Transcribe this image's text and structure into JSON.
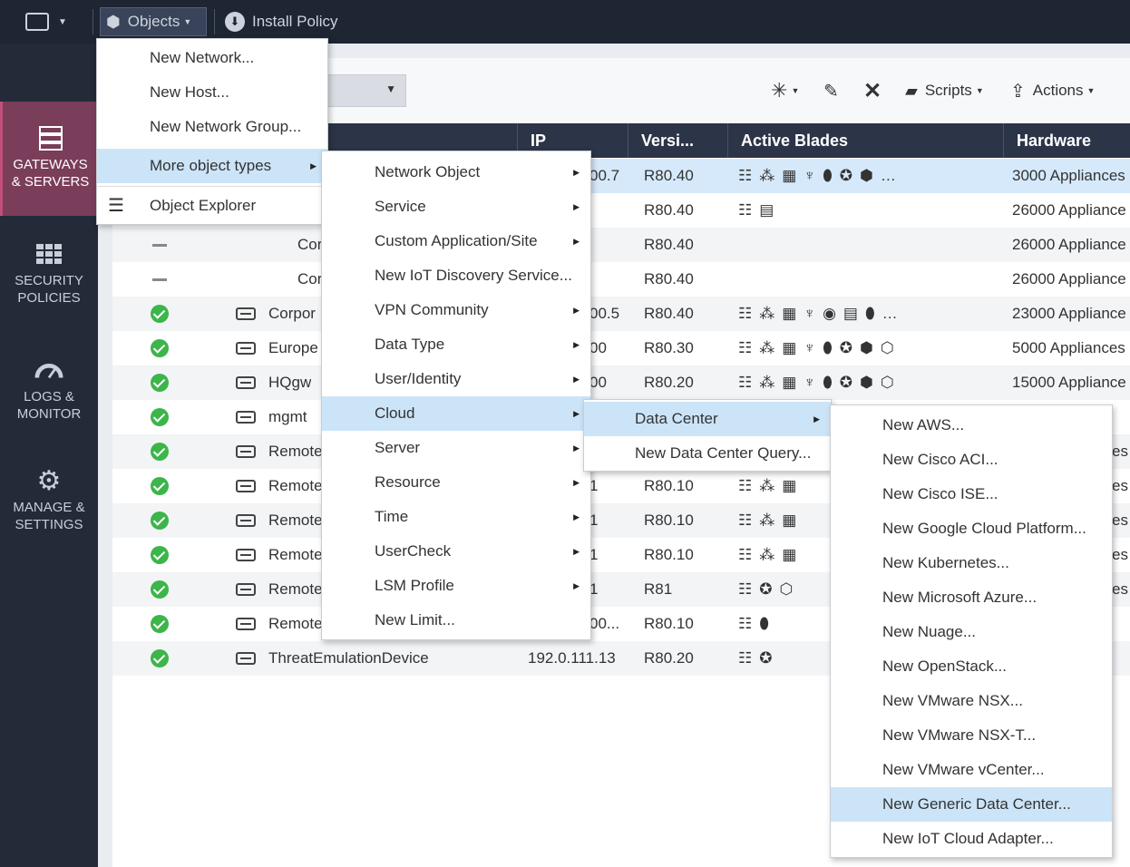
{
  "topbar": {
    "objects_label": "Objects",
    "install_policy_label": "Install Policy"
  },
  "nav": {
    "gateways": "GATEWAYS & SERVERS",
    "security": "SECURITY POLICIES",
    "logs": "LOGS & MONITOR",
    "manage": "MANAGE & SETTINGS"
  },
  "toolbar": {
    "scripts_label": "Scripts",
    "actions_label": "Actions"
  },
  "table": {
    "headers": {
      "ip": "IP",
      "version": "Versi...",
      "blades": "Active Blades",
      "hardware": "Hardware"
    },
    "rows": [
      {
        "name": "",
        "ip": "00.7",
        "version": "R80.40",
        "hardware": "3000 Appliances"
      },
      {
        "name": "",
        "ip": "",
        "version": "R80.40",
        "hardware": "26000 Appliance"
      },
      {
        "name": "Cor",
        "ip": "",
        "version": "R80.40",
        "hardware": "26000 Appliance"
      },
      {
        "name": "Cor",
        "ip": "",
        "version": "R80.40",
        "hardware": "26000 Appliance"
      },
      {
        "name": "Corpor",
        "ip": "00.5",
        "version": "R80.40",
        "hardware": "23000 Appliance"
      },
      {
        "name": "Europe",
        "ip": "00",
        "version": "R80.30",
        "hardware": "5000 Appliances"
      },
      {
        "name": "HQgw",
        "ip": "00",
        "version": "R80.20",
        "hardware": "15000 Appliance"
      },
      {
        "name": "mgmt",
        "ip": "",
        "version": "",
        "hardware": ""
      },
      {
        "name": "Remote",
        "ip": "",
        "version": "",
        "hardware": "es"
      },
      {
        "name": "Remote",
        "ip": "1",
        "version": "R80.10",
        "hardware": "es"
      },
      {
        "name": "Remote",
        "ip": "1",
        "version": "R80.10",
        "hardware": "es"
      },
      {
        "name": "Remote",
        "ip": "1",
        "version": "R80.10",
        "hardware": "es"
      },
      {
        "name": "Remote",
        "ip": "1",
        "version": "R81",
        "hardware": "es"
      },
      {
        "name": "Remote",
        "ip": "00...",
        "version": "R80.10",
        "hardware": ""
      },
      {
        "name": "ThreatEmulationDevice",
        "ip": "192.0.111.13",
        "version": "R80.20",
        "hardware": ""
      }
    ]
  },
  "menu_objects": [
    {
      "label": "New Network..."
    },
    {
      "label": "New Host..."
    },
    {
      "label": "New Network Group..."
    },
    {
      "label": "More object types"
    },
    {
      "label": "Object Explorer"
    }
  ],
  "menu_more": [
    {
      "label": "Network Object"
    },
    {
      "label": "Service"
    },
    {
      "label": "Custom Application/Site"
    },
    {
      "label": "New IoT Discovery Service..."
    },
    {
      "label": "VPN Community"
    },
    {
      "label": "Data Type"
    },
    {
      "label": "User/Identity"
    },
    {
      "label": "Cloud"
    },
    {
      "label": "Server"
    },
    {
      "label": "Resource"
    },
    {
      "label": "Time"
    },
    {
      "label": "UserCheck"
    },
    {
      "label": "LSM Profile"
    },
    {
      "label": "New Limit..."
    }
  ],
  "menu_cloud": [
    {
      "label": "Data Center"
    },
    {
      "label": "New Data Center Query..."
    }
  ],
  "menu_dc": [
    {
      "label": "New AWS..."
    },
    {
      "label": "New Cisco ACI..."
    },
    {
      "label": "New Cisco ISE..."
    },
    {
      "label": "New Google Cloud Platform..."
    },
    {
      "label": "New Kubernetes..."
    },
    {
      "label": "New Microsoft Azure..."
    },
    {
      "label": "New Nuage..."
    },
    {
      "label": "New OpenStack..."
    },
    {
      "label": "New VMware NSX..."
    },
    {
      "label": "New VMware NSX-T..."
    },
    {
      "label": "New VMware vCenter..."
    },
    {
      "label": "New Generic Data Center..."
    },
    {
      "label": "New IoT Cloud Adapter..."
    }
  ],
  "colors": {
    "accent": "#cce4f7",
    "nav_active": "#7a3d5a",
    "header": "#2c3547",
    "ok": "#3cb54a"
  }
}
